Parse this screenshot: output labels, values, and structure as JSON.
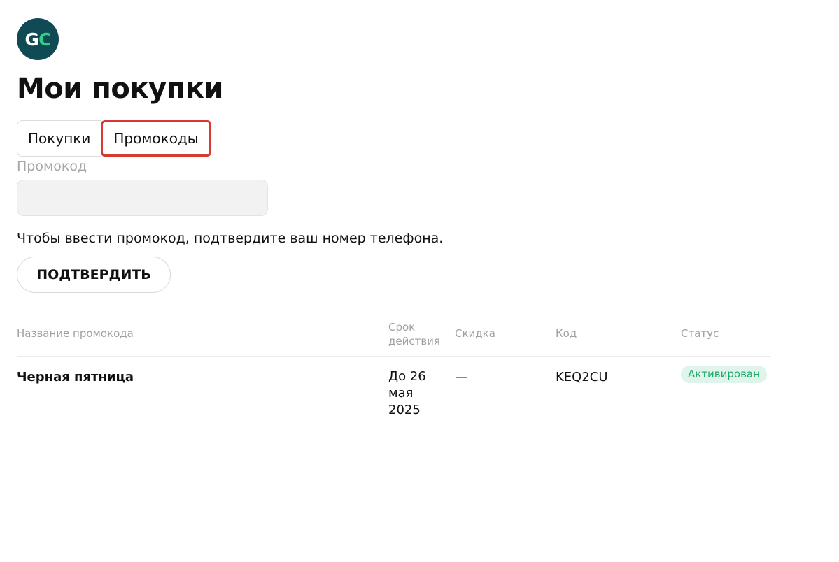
{
  "logo": {
    "g": "G",
    "c": "C"
  },
  "page": {
    "title": "Мои покупки"
  },
  "tabs": [
    {
      "label": "Покупки",
      "active": false
    },
    {
      "label": "Промокоды",
      "active": true
    }
  ],
  "promo_form": {
    "label": "Промокод",
    "value": "",
    "hint": "Чтобы ввести промокод, подтвердите ваш номер телефона.",
    "confirm_label": "ПОДТВЕРДИТЬ"
  },
  "table": {
    "headers": {
      "name": "Название промокода",
      "term": "Срок действия",
      "discount": "Скидка",
      "code": "Код",
      "status": "Статус"
    },
    "rows": [
      {
        "name": "Черная пятница",
        "term": "До 26 мая 2025",
        "discount": "—",
        "code": "KEQ2CU",
        "status": "Активирован"
      }
    ]
  },
  "colors": {
    "logo_bg": "#0f4a55",
    "logo_accent": "#2fd08a",
    "active_tab_border": "#d63a32",
    "status_bg": "#dff4ea",
    "status_text": "#1fa868"
  }
}
